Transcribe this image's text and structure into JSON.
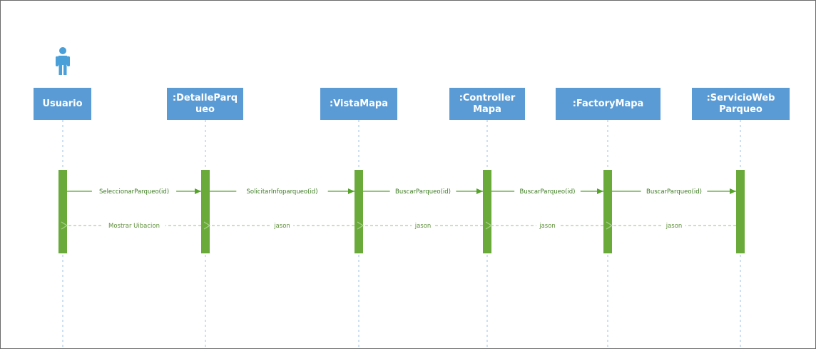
{
  "colors": {
    "header_fill": "#5b9bd5",
    "header_text": "#ffffff",
    "actor": "#4a9fd8",
    "lifeline": "#9dc3e6",
    "activation": "#6aaa3a",
    "call_arrow": "#55a32a",
    "return_arrow": "#a9d18e",
    "border": "#6b6b6b"
  },
  "actor": {
    "icon": "person-icon"
  },
  "participants": [
    {
      "label": "Usuario",
      "lines": [
        "Usuario"
      ]
    },
    {
      "label": ":DetalleParqueo",
      "lines": [
        ":DetalleParq",
        "ueo"
      ]
    },
    {
      "label": ":VistaMapa",
      "lines": [
        ":VistaMapa"
      ]
    },
    {
      "label": ":ControllerMapa",
      "lines": [
        ":Controller",
        "Mapa"
      ]
    },
    {
      "label": ":FactoryMapa",
      "lines": [
        ":FactoryMapa"
      ]
    },
    {
      "label": ":ServicioWebParqueo",
      "lines": [
        ":ServicioWeb",
        "Parqueo"
      ]
    }
  ],
  "calls": [
    {
      "from": 0,
      "to": 1,
      "label": "SeleccionarParqueo(id)"
    },
    {
      "from": 1,
      "to": 2,
      "label": "SolicitarInfoparqueo(id)"
    },
    {
      "from": 2,
      "to": 3,
      "label": "BuscarParqueo(id)"
    },
    {
      "from": 3,
      "to": 4,
      "label": "BuscarParqueo(id)"
    },
    {
      "from": 4,
      "to": 5,
      "label": "BuscarParqueo(id)"
    }
  ],
  "returns": [
    {
      "from": 1,
      "to": 0,
      "label": "Mostrar Uibacion"
    },
    {
      "from": 2,
      "to": 1,
      "label": "jason"
    },
    {
      "from": 3,
      "to": 2,
      "label": "jason"
    },
    {
      "from": 4,
      "to": 3,
      "label": "jason"
    },
    {
      "from": 5,
      "to": 4,
      "label": "jason"
    }
  ]
}
